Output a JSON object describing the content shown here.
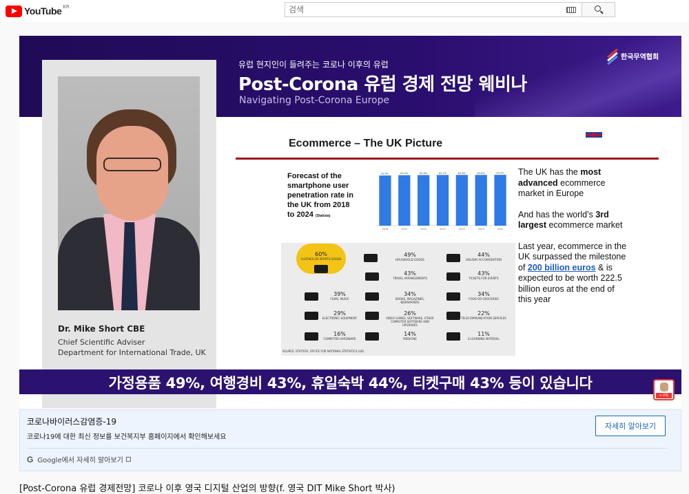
{
  "header": {
    "logo_text": "YouTube",
    "region": "KR",
    "search_placeholder": "검색"
  },
  "video": {
    "banner": {
      "subtitle": "유럽 현지인이 들려주는 코로나 이후의 유럽",
      "title": "Post-Corona 유럽 경제 전망 웨비나",
      "english": "Navigating Post-Corona Europe",
      "org_logo": "한국무역협회"
    },
    "speaker": {
      "name": "Dr. Mike Short CBE",
      "role_line1": "Chief Scientific Adviser",
      "role_line2": "Department for International Trade, UK"
    },
    "slide": {
      "title": "Ecommerce – The UK Picture",
      "forecast_label": "Forecast of the smartphone user penetration rate in the UK from 2018 to 2024",
      "forecast_source": "(Statista)",
      "text_p1_a": "The UK has the ",
      "text_p1_b": "most advanced",
      "text_p1_c": " ecommerce market in Europe",
      "text_p2_a": "And has the world’s ",
      "text_p2_b": "3rd largest",
      "text_p2_c": " ecommerce market",
      "text_p3_a": "Last year, ecommerce in the UK surpassed the milestone of ",
      "text_p3_link": "200 billion euros",
      "text_p3_c": " & is expected to be worth 222.5 billion euros at the end of this year",
      "infographic": [
        {
          "pct": "60%",
          "label": "CLOTHES OR SPORTS GOODS"
        },
        {
          "pct": "49%",
          "label": "HOUSEHOLD GOODS"
        },
        {
          "pct": "44%",
          "label": "HOLIDAY ACCOMODATION"
        },
        {
          "pct": "43%",
          "label": "TRAVEL ARRANGEMENTS"
        },
        {
          "pct": "43%",
          "label": "TICKETS FOR EVENTS"
        },
        {
          "pct": "39%",
          "label": "FILMS, MUSIC"
        },
        {
          "pct": "34%",
          "label": "BOOKS, MAGAZINES, NEWSPAPERS"
        },
        {
          "pct": "34%",
          "label": "FOOD OR GROCERIES"
        },
        {
          "pct": "29%",
          "label": "ELECTRONIC EQUIPMENT"
        },
        {
          "pct": "26%",
          "label": "VIDEO GAMES, SOFTWARE, OTHER COMPUTER SOFTWARE AND UPGRADES"
        },
        {
          "pct": "22%",
          "label": "TELECOMMUNICATION SERVICES"
        },
        {
          "pct": "16%",
          "label": "COMPUTER HARDWARE"
        },
        {
          "pct": "14%",
          "label": "MEDICINE"
        },
        {
          "pct": "11%",
          "label": "E-LEARNING MATERIAL"
        }
      ],
      "infographic_source": "SOURCE: STATISTA, OFFICE FOR NATIONAL STATISTICS (UK)"
    },
    "caption": "가정용품 49%, 여행경비 43%, 휴일숙박 44%, 티켓구매 43% 등이 있습니다",
    "subscribe_label": "+구독"
  },
  "chart_data": {
    "type": "bar",
    "categories": [
      "2018",
      "2019",
      "2020",
      "2021",
      "2022",
      "2023",
      "2024"
    ],
    "values": [
      82.9,
      83.4,
      83.6,
      83.7,
      83.8,
      83.8,
      83.9
    ],
    "ylim": [
      0,
      100
    ],
    "bar_color": "#2f7ae5"
  },
  "covid_panel": {
    "title": "코로나바이러스감염증-19",
    "description": "코로나19에 대한 최신 정보를 보건복지부 홈페이지에서 확인해보세요",
    "button_label": "자세히 알아보기",
    "google_text": "Google에서 자세히 알아보기"
  },
  "video_title": "[Post-Corona 유럽 경제전망] 코로나 이후 영국 디지털 산업의 방향(f. 영국 DIT Mike Short 박사)",
  "colors": {
    "banner": "#1f0b57",
    "accent_red": "#a01020",
    "link_blue": "#1a5bc4",
    "highlight_yellow": "#f3c316"
  }
}
